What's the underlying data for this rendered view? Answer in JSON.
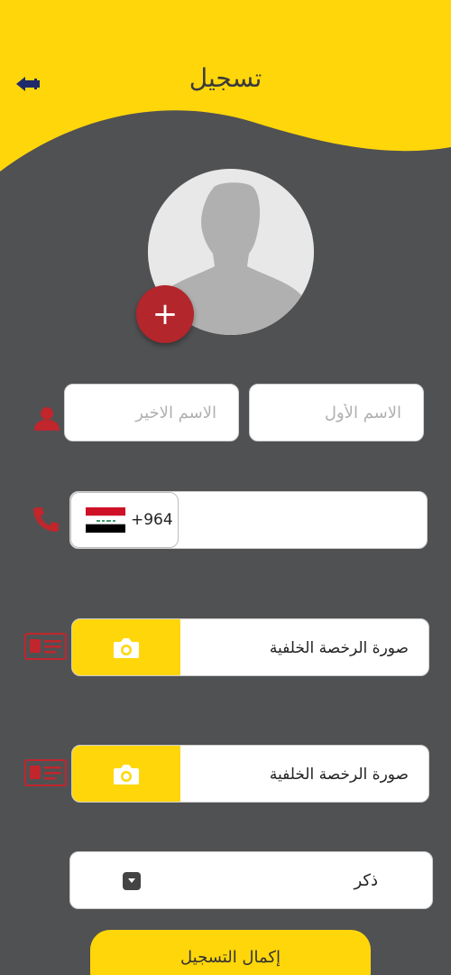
{
  "header": {
    "title": "تسجيل",
    "back_icon": "arrow-left-icon",
    "background_color": "#ffd60a"
  },
  "profile": {
    "avatar_icon": "person-silhouette-icon",
    "add_button_icon": "plus-icon",
    "add_button_color": "#b3262b"
  },
  "name": {
    "icon": "person-icon",
    "first_name_placeholder": "الاسم الأول",
    "last_name_placeholder": "الاسم الاخير"
  },
  "phone": {
    "icon": "phone-icon",
    "dial_code": "+964",
    "country_flag": "iraq-flag-icon",
    "value": ""
  },
  "license_back_1": {
    "icon": "id-card-icon",
    "label": "صورة الرخصة الخلفية",
    "button_icon": "camera-icon"
  },
  "license_back_2": {
    "icon": "id-card-icon",
    "label": "صورة الرخصة الخلفية",
    "button_icon": "camera-icon"
  },
  "gender": {
    "selected": "ذكر",
    "icon": "dropdown-arrow-icon"
  },
  "submit": {
    "label": "إكمال التسجيل"
  },
  "colors": {
    "background": "#505153",
    "accent": "#ffd60a",
    "icon_red": "#c0262c",
    "field": "#ffffff"
  }
}
